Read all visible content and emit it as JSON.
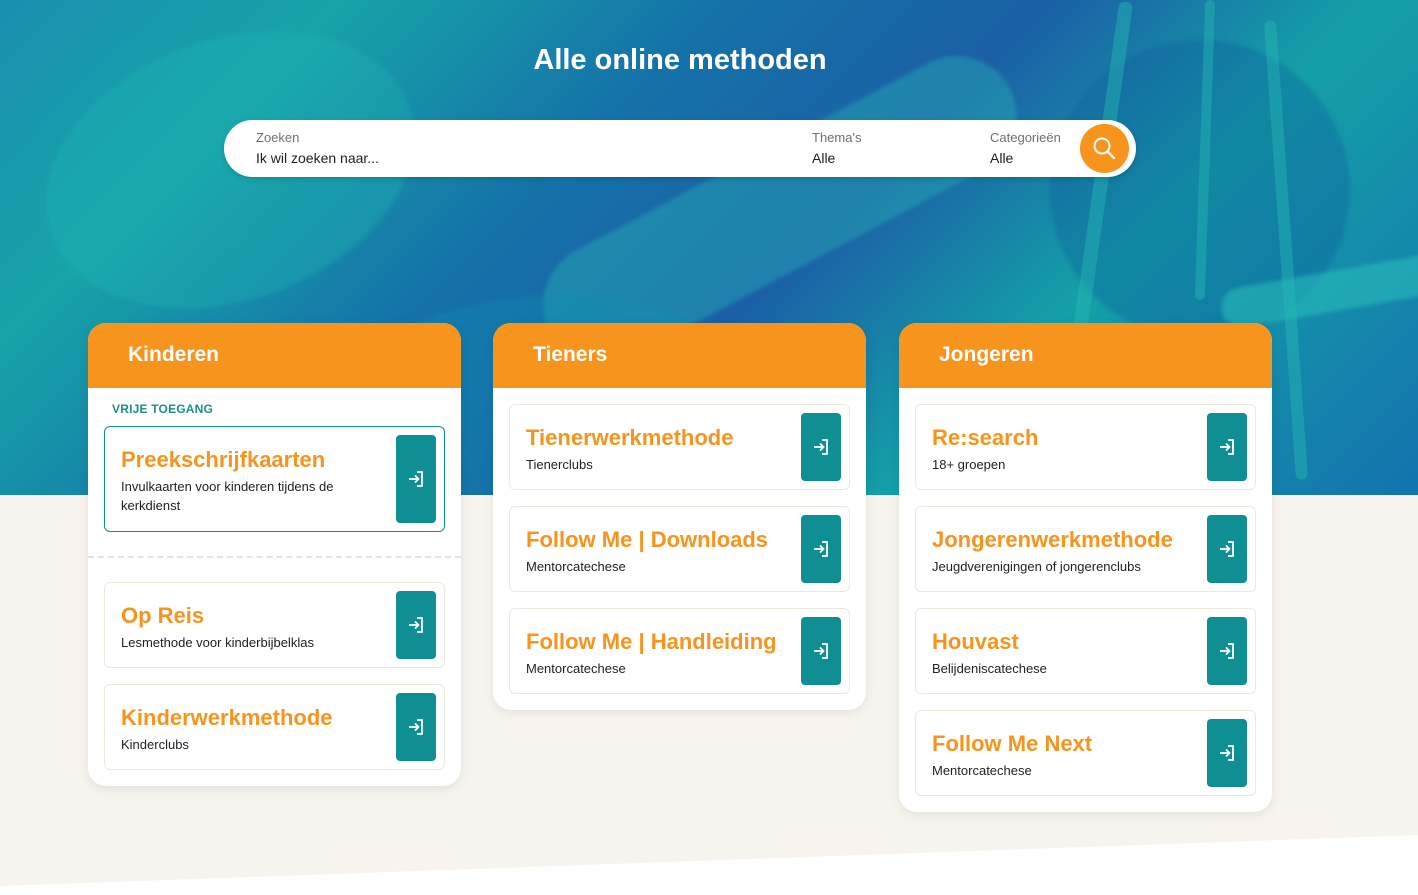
{
  "page": {
    "title": "Alle online methoden"
  },
  "search": {
    "query_label": "Zoeken",
    "query_placeholder": "Ik wil zoeken naar...",
    "theme_label": "Thema's",
    "theme_value": "Alle",
    "category_label": "Categorieën",
    "category_value": "Alle",
    "button_icon": "search-icon"
  },
  "colors": {
    "accent": "#f7941d",
    "teal": "#0f8f94",
    "background": "#f6f4ec"
  },
  "columns": [
    {
      "title": "Kinderen",
      "free_label": "VRIJE TOEGANG",
      "free_card": {
        "title": "Preekschrijfkaarten",
        "subtitle": "Invulkaarten voor kinderen tijdens de kerkdienst"
      },
      "cards": [
        {
          "title": "Op Reis",
          "subtitle": "Lesmethode voor kinderbijbelklas"
        },
        {
          "title": "Kinderwerkmethode",
          "subtitle": "Kinderclubs"
        }
      ]
    },
    {
      "title": "Tieners",
      "cards": [
        {
          "title": "Tienerwerkmethode",
          "subtitle": "Tienerclubs"
        },
        {
          "title": "Follow Me | Downloads",
          "subtitle": "Mentorcatechese"
        },
        {
          "title": "Follow Me | Handleiding",
          "subtitle": "Mentorcatechese"
        }
      ]
    },
    {
      "title": "Jongeren",
      "cards": [
        {
          "title": "Re:search",
          "subtitle": "18+ groepen"
        },
        {
          "title": "Jongerenwerkmethode",
          "subtitle": "Jeugdverenigingen of jongerenclubs"
        },
        {
          "title": "Houvast",
          "subtitle": "Belijdeniscatechese"
        },
        {
          "title": "Follow Me Next",
          "subtitle": "Mentorcatechese"
        }
      ]
    }
  ]
}
